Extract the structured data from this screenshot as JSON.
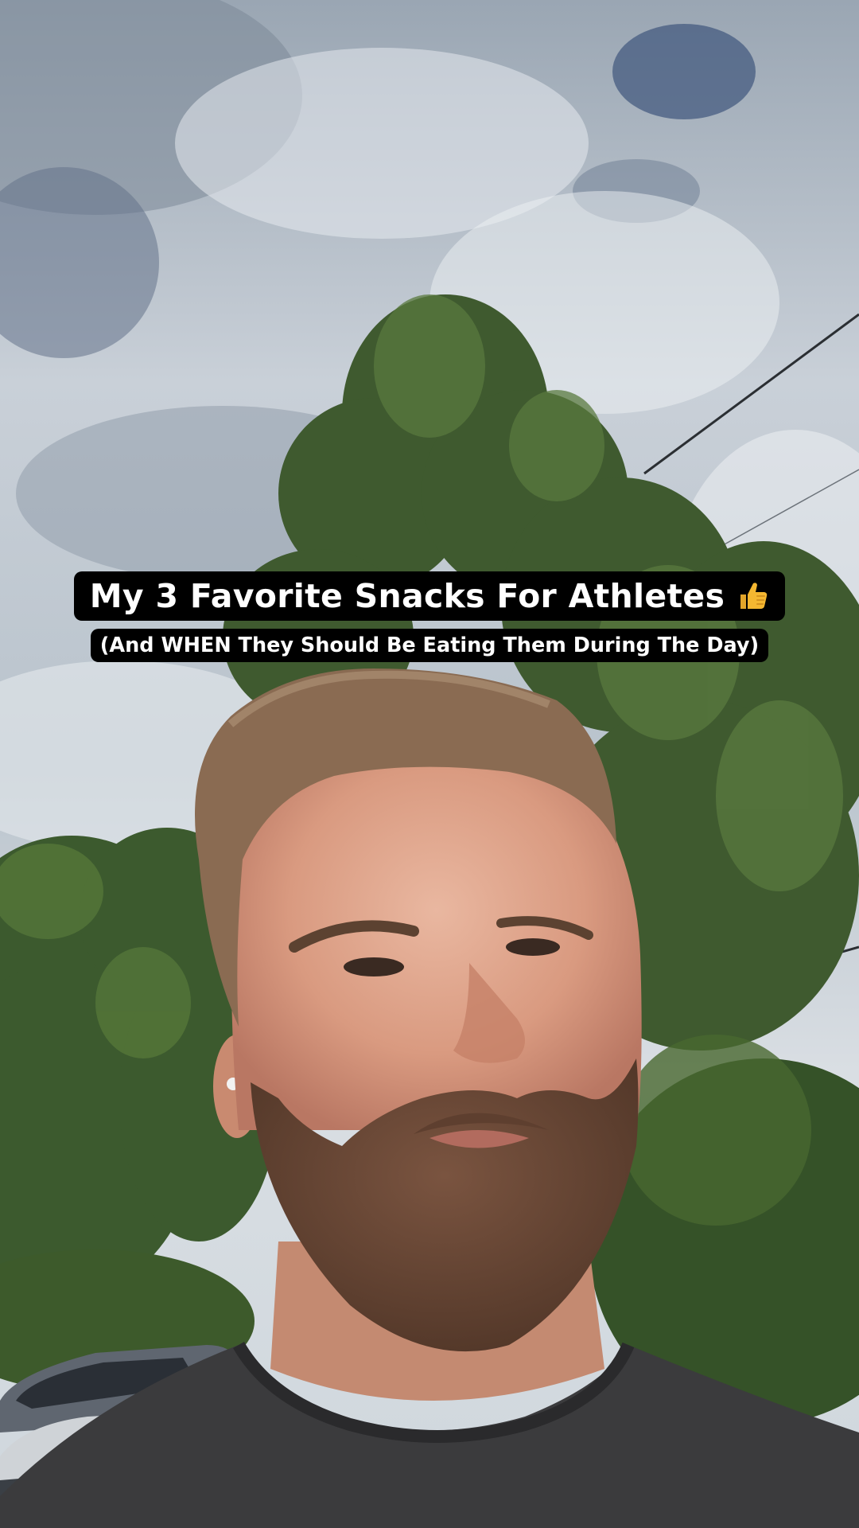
{
  "overlay": {
    "title_text": "My 3 Favorite Snacks For Athletes",
    "title_icon": "thumbs-up-icon",
    "subtitle_text": "(And WHEN They Should Be Eating Them During The Day)"
  },
  "colors": {
    "caption_background": "#000000",
    "caption_text": "#ffffff",
    "thumb_emoji": "#f4b731"
  }
}
